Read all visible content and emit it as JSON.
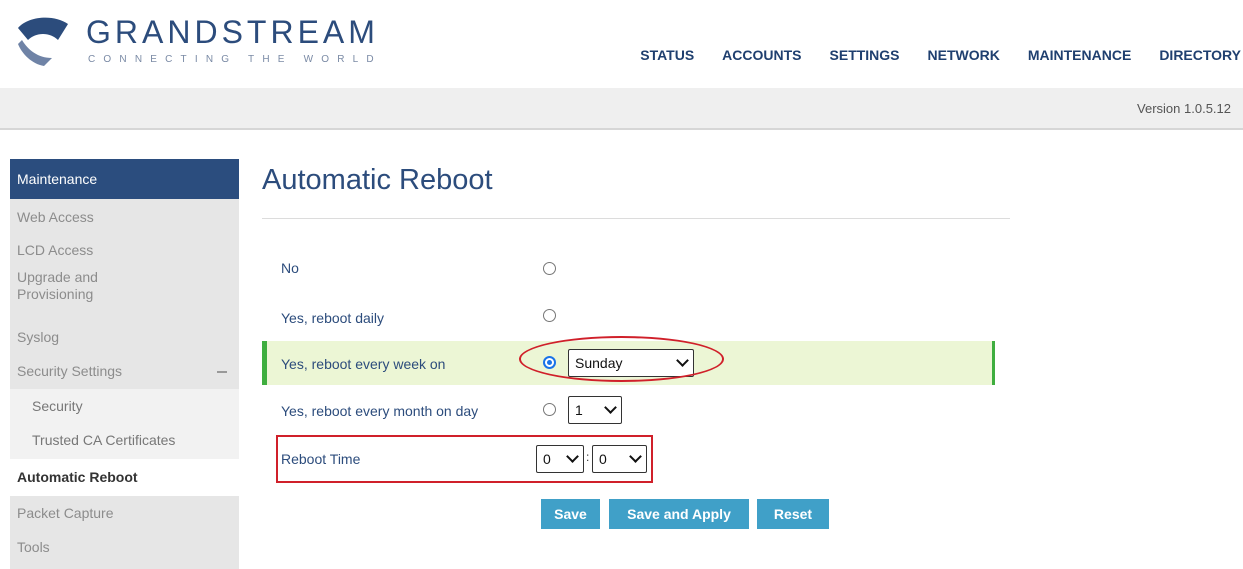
{
  "brand": {
    "name": "GRANDSTREAM",
    "tagline": "CONNECTING THE WORLD"
  },
  "topnav": [
    "STATUS",
    "ACCOUNTS",
    "SETTINGS",
    "NETWORK",
    "MAINTENANCE",
    "DIRECTORY"
  ],
  "version": "Version 1.0.5.12",
  "sidebar": {
    "header": "Maintenance",
    "items": [
      {
        "label": "Web Access"
      },
      {
        "label": "LCD Access"
      },
      {
        "label": "Upgrade and\nProvisioning"
      },
      {
        "label": "Syslog"
      },
      {
        "label": "Security Settings"
      },
      {
        "label": "Security"
      },
      {
        "label": "Trusted CA Certificates"
      },
      {
        "label": "Automatic Reboot"
      },
      {
        "label": "Packet Capture"
      },
      {
        "label": "Tools"
      }
    ]
  },
  "page": {
    "title": "Automatic Reboot"
  },
  "options": {
    "no": "No",
    "daily": "Yes, reboot daily",
    "weekly": "Yes, reboot every week on",
    "monthly": "Yes, reboot every month on day",
    "selected": "weekly",
    "weekday_value": "Sunday",
    "month_day_value": "1"
  },
  "reboot_time": {
    "label": "Reboot Time",
    "hour": "0",
    "separator": ":",
    "minute": "0"
  },
  "buttons": {
    "save": "Save",
    "save_apply": "Save and Apply",
    "reset": "Reset"
  },
  "colors": {
    "brand_blue": "#2c4c7c",
    "sidebar_header": "#2b4d7e",
    "highlight_bg": "#ecf6d5",
    "highlight_border": "#3fae3f",
    "annotation_red": "#d0202a",
    "button": "#40a0c8"
  }
}
